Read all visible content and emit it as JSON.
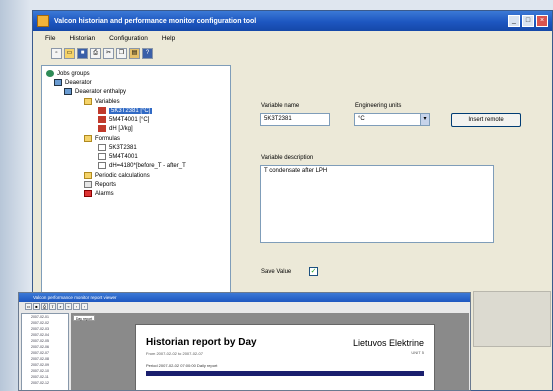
{
  "window": {
    "title": "Valcon historian and performance monitor configuration tool",
    "controls": [
      "_",
      "□",
      "×"
    ]
  },
  "menu": [
    "File",
    "Historian",
    "Configuration",
    "Help"
  ],
  "toolbar_icons": [
    "new-icon",
    "open-icon",
    "save-icon",
    "print-icon",
    "cut-icon",
    "copy-icon",
    "paste-icon",
    "help-icon"
  ],
  "tree": {
    "root": "Jobs groups",
    "deaerator": "Deaerator",
    "enthalpy": "Deaerator enthalpy",
    "variables": "Variables",
    "var_items": [
      "5K3T2381 [°C]",
      "5M4T4001 [°C]",
      "dH [J/kg]"
    ],
    "formulas": "Formulas",
    "formula_items": [
      "5K3T2381",
      "5M4T4001",
      "dH=4180*[before_T - after_T"
    ],
    "periodic": "Periodic calculations",
    "reports": "Reports",
    "alarms": "Alarms"
  },
  "form": {
    "variable_name_label": "Variable name",
    "variable_name_value": "5K3T2381",
    "units_label": "Engineering units",
    "units_value": "°C",
    "insert_remote": "Insert remote",
    "desc_label": "Variable description",
    "desc_value": "T condensate after LPH",
    "save_value_label": "Save Value",
    "save_value_checked": true
  },
  "report_window": {
    "title": "Valcon performance monitor report viewer",
    "tab": "Day report",
    "list_items": [
      "2007-02-01",
      "2007-02-02",
      "2007-02-03",
      "2007-02-04",
      "2007-02-05",
      "2007-02-06",
      "2007-02-07",
      "2007-02-08",
      "2007-02-09",
      "2007-02-10",
      "2007-02-11",
      "2007-02-12"
    ],
    "report_title": "Historian report by Day",
    "report_period": "From 2007-02-02 to 2007-02-07",
    "company": "Lietuvos Elektrine",
    "unit": "UNIT 5",
    "row_text": "Period  2007-02-02    07:00:00                 Daily report"
  },
  "colors": {
    "titlebar": "#1d56c0",
    "selection": "#316ac5",
    "report_header": "#1a1f6e"
  }
}
